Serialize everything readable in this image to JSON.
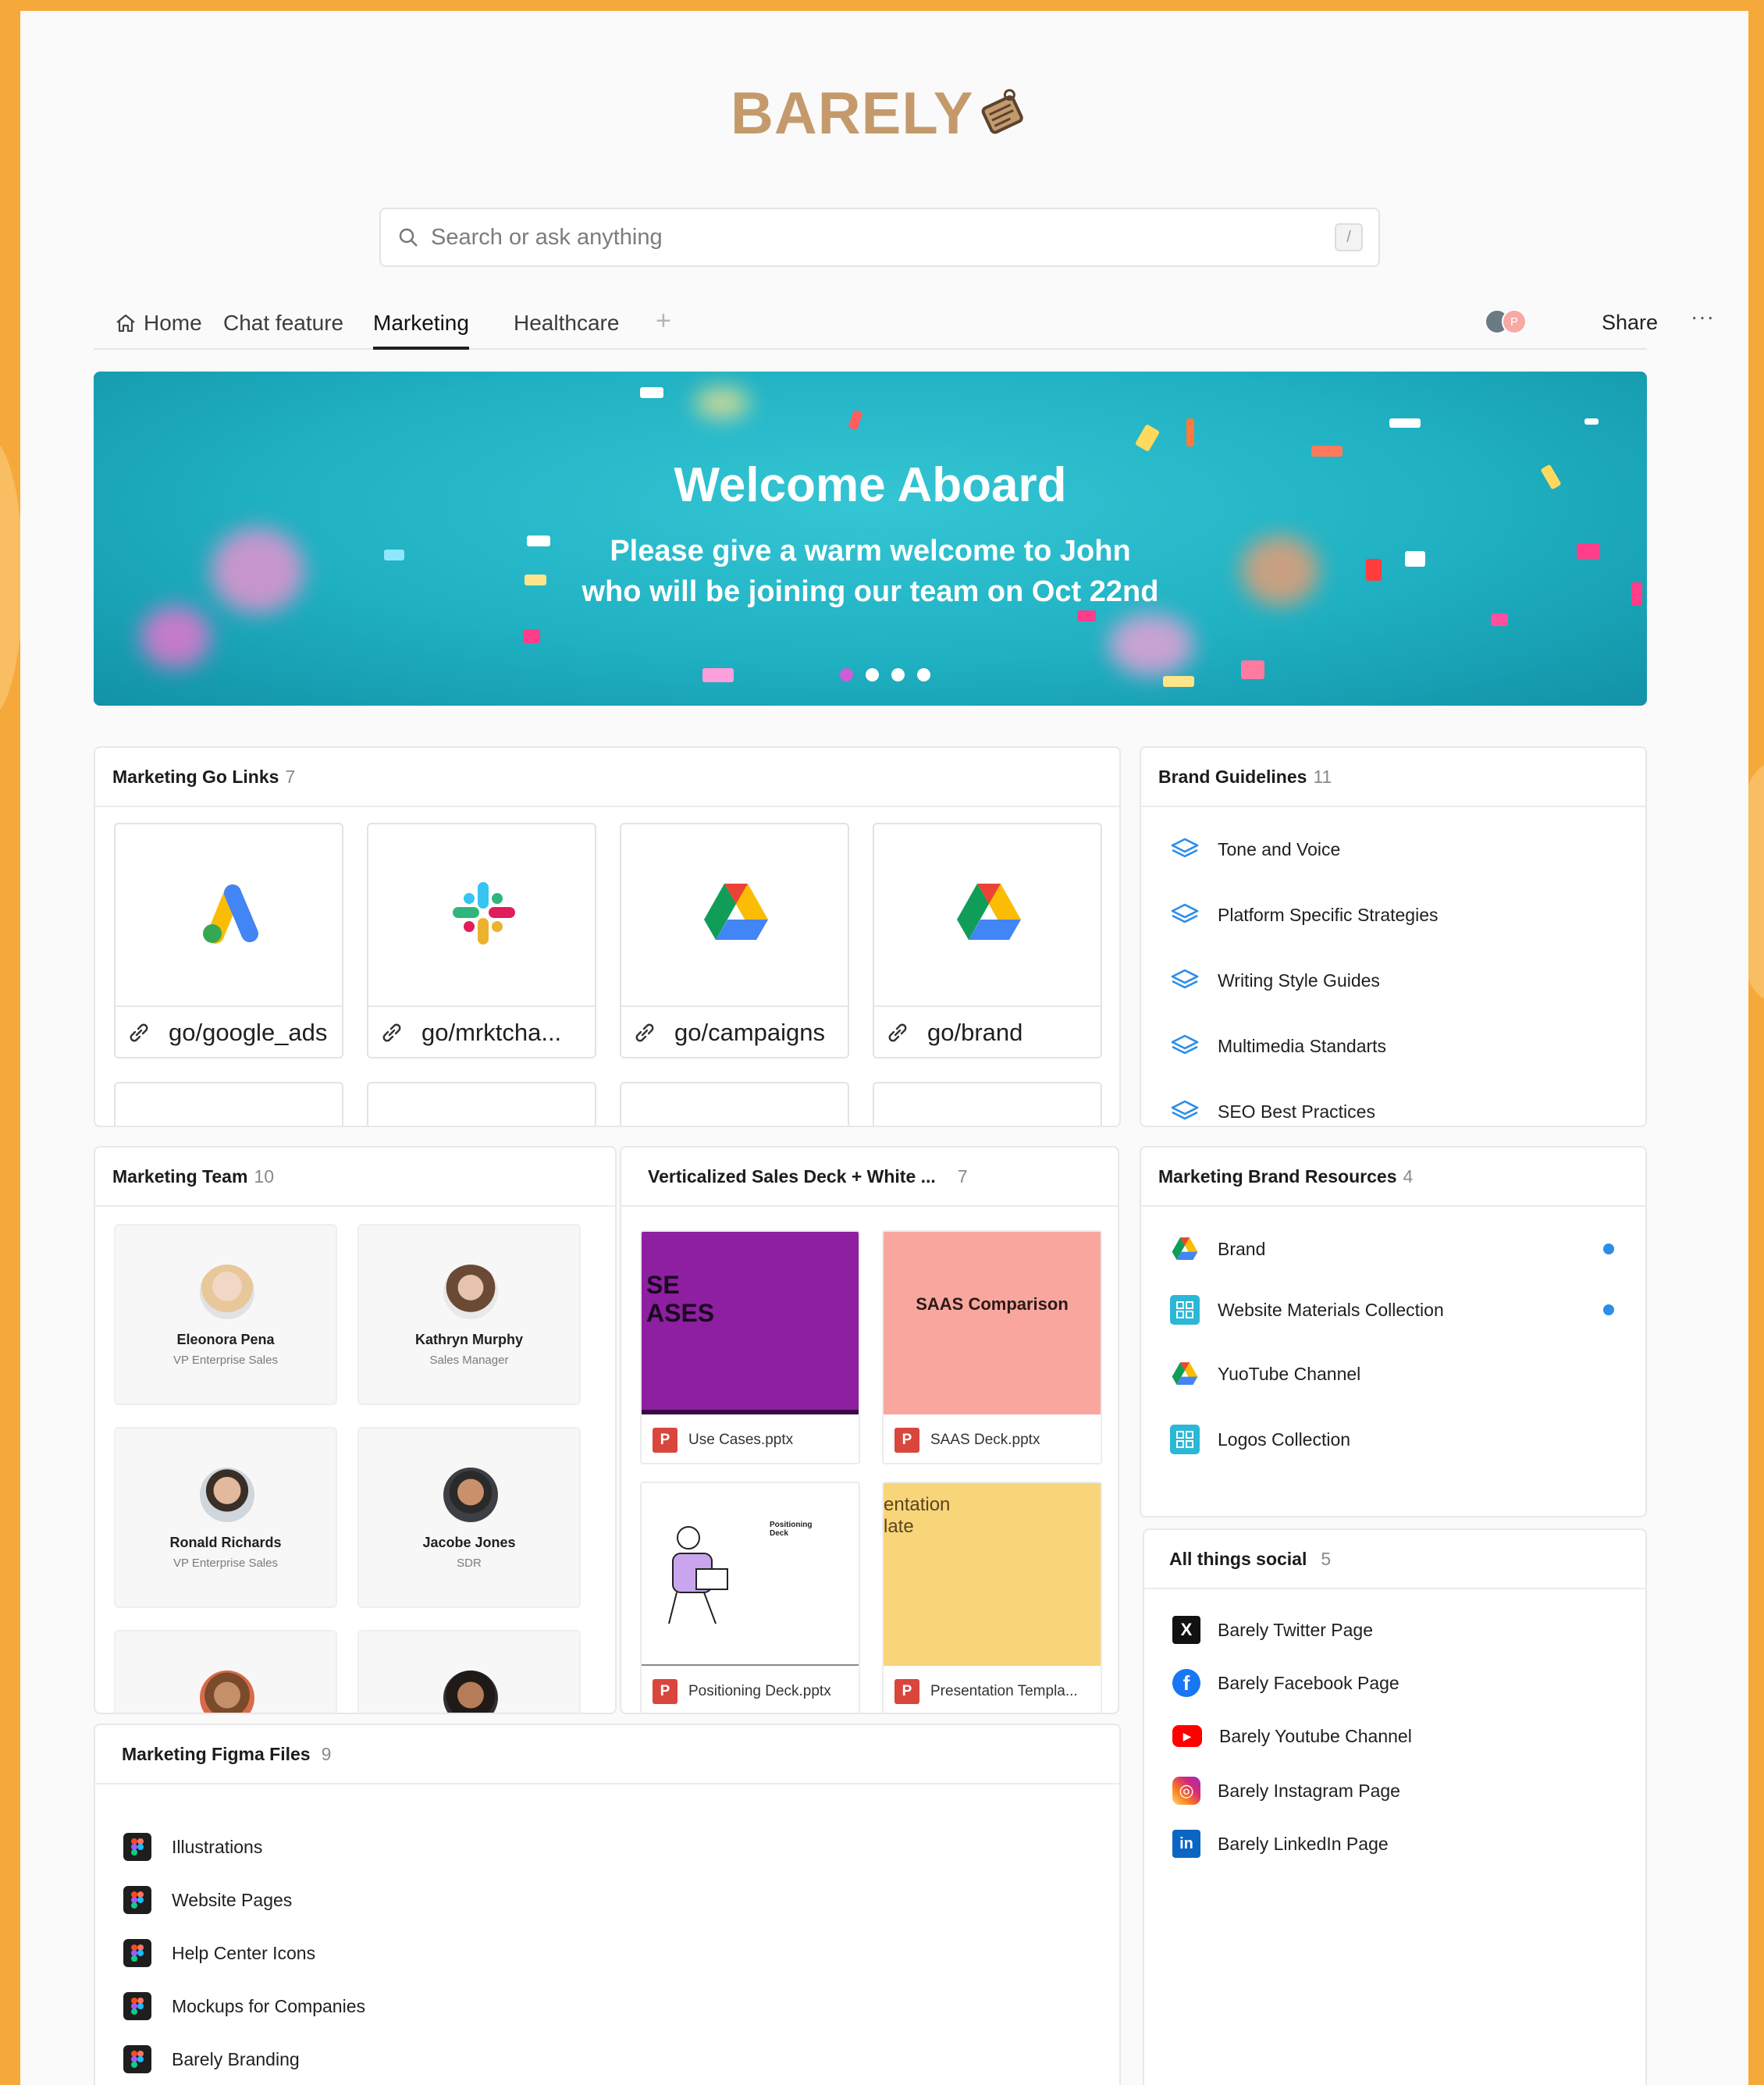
{
  "brand": {
    "name": "BARELY",
    "accent": "#c49a6c",
    "background": "#f6a93b"
  },
  "search": {
    "placeholder": "Search or ask anything",
    "shortcut": "/"
  },
  "tabs": [
    {
      "label": "Home",
      "icon": "home-icon"
    },
    {
      "label": "Chat feature"
    },
    {
      "label": "Marketing",
      "active": true
    },
    {
      "label": "Healthcare"
    }
  ],
  "toolbar": {
    "add_tab": "+",
    "share_label": "Share",
    "more_label": "···",
    "avatar_initial": "P"
  },
  "banner": {
    "title": "Welcome Aboard",
    "subtitle": "Please give a warm welcome to John who will be joining our team on Oct 22nd",
    "slide_count": 4,
    "active_slide": 1
  },
  "go_links": {
    "title": "Marketing Go Links",
    "count": "7",
    "items": [
      {
        "label": "go/google_ads",
        "icon": "google-ads-icon"
      },
      {
        "label": "go/mrktcha...",
        "icon": "slack-icon"
      },
      {
        "label": "go/campaigns",
        "icon": "google-drive-icon"
      },
      {
        "label": "go/brand",
        "icon": "google-drive-icon"
      }
    ]
  },
  "brand_guidelines": {
    "title": "Brand Guidelines",
    "count": "11",
    "items": [
      {
        "label": "Tone and Voice",
        "icon": "layers-icon"
      },
      {
        "label": "Platform Specific Strategies",
        "icon": "layers-icon"
      },
      {
        "label": "Writing Style Guides",
        "icon": "layers-icon"
      },
      {
        "label": "Multimedia Standarts",
        "icon": "layers-icon"
      },
      {
        "label": "SEO Best Practices",
        "icon": "layers-icon"
      }
    ]
  },
  "team": {
    "title": "Marketing Team",
    "count": "10",
    "members": [
      {
        "name": "Eleonora Pena",
        "role": "VP Enterprise Sales"
      },
      {
        "name": "Kathryn Murphy",
        "role": "Sales Manager"
      },
      {
        "name": "Ronald Richards",
        "role": "VP Enterprise Sales"
      },
      {
        "name": "Jacobe Jones",
        "role": "SDR"
      },
      {
        "name": "",
        "role": ""
      },
      {
        "name": "",
        "role": ""
      }
    ]
  },
  "decks": {
    "title": "Verticalized Sales Deck + White ...",
    "count": "7",
    "items": [
      {
        "file": "Use Cases.pptx",
        "thumb_text": "SE\nASES",
        "thumb_color": "#8d1fa0"
      },
      {
        "file": "SAAS Deck.pptx",
        "thumb_text": "SAAS Comparison",
        "thumb_color": "#f9a79e"
      },
      {
        "file": "Positioning Deck.pptx",
        "thumb_text": "Positioning Deck",
        "thumb_color": "#ffffff"
      },
      {
        "file": "Presentation Templa...",
        "thumb_text": "entation\nlate",
        "thumb_color": "#f9d57a"
      }
    ],
    "file_badge": "P"
  },
  "brand_resources": {
    "title": "Marketing Brand Resources",
    "count": "4",
    "items": [
      {
        "label": "Brand",
        "icon": "google-drive-icon",
        "unread": true
      },
      {
        "label": "Website Materials Collection",
        "icon": "grid-icon",
        "unread": true
      },
      {
        "label": "YuoTube Channel",
        "icon": "google-drive-icon",
        "unread": false
      },
      {
        "label": "Logos Collection",
        "icon": "grid-icon",
        "unread": false
      }
    ]
  },
  "social": {
    "title": "All things social",
    "count": "5",
    "items": [
      {
        "label": "Barely Twitter Page",
        "icon": "x-icon",
        "glyph": "X"
      },
      {
        "label": "Barely Facebook Page",
        "icon": "facebook-icon",
        "glyph": "f"
      },
      {
        "label": "Barely Youtube Channel",
        "icon": "youtube-icon",
        "glyph": "▶"
      },
      {
        "label": "Barely Instagram Page",
        "icon": "instagram-icon",
        "glyph": "◎"
      },
      {
        "label": "Barely LinkedIn Page",
        "icon": "linkedin-icon",
        "glyph": "in"
      }
    ]
  },
  "figma": {
    "title": "Marketing Figma Files",
    "count": "9",
    "items": [
      {
        "label": "Illustrations"
      },
      {
        "label": "Website Pages"
      },
      {
        "label": "Help Center Icons"
      },
      {
        "label": "Mockups for Companies"
      },
      {
        "label": "Barely Branding"
      }
    ]
  }
}
